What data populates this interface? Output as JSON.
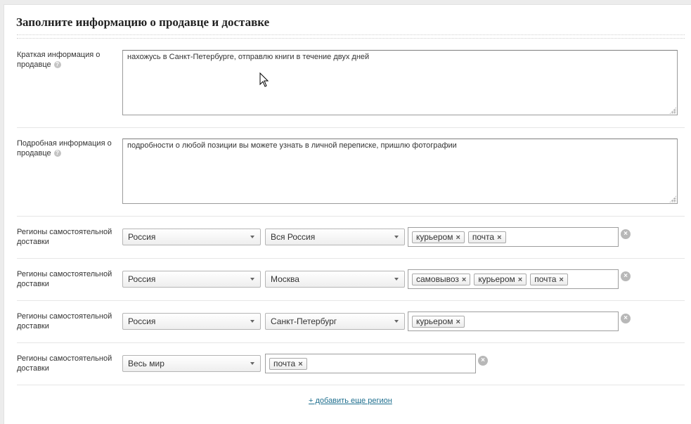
{
  "title": "Заполните информацию о продавце и доставке",
  "short_info": {
    "label": "Краткая информация о продавце",
    "value": "нахожусь в Санкт-Петербурге, отправлю книги в течение двух дней"
  },
  "detailed_info": {
    "label": "Подробная информация о продавце",
    "value": "подробности о любой позиции вы можете узнать в личной переписке, пришлю фотографии"
  },
  "regions": [
    {
      "label": "Регионы самостоятельной доставки",
      "country": "Россия",
      "region": "Вся Россия",
      "tags": [
        "курьером",
        "почта"
      ]
    },
    {
      "label": "Регионы самостоятельной доставки",
      "country": "Россия",
      "region": "Москва",
      "tags": [
        "самовывоз",
        "курьером",
        "почта"
      ]
    },
    {
      "label": "Регионы самостоятельной доставки",
      "country": "Россия",
      "region": "Санкт-Петербург",
      "tags": [
        "курьером"
      ]
    },
    {
      "label": "Регионы самостоятельной доставки",
      "country": "Весь мир",
      "tags": [
        "почта"
      ]
    }
  ],
  "add_region_label": "+ добавить еще регион",
  "help_glyph": "?",
  "remove_glyph": "×"
}
